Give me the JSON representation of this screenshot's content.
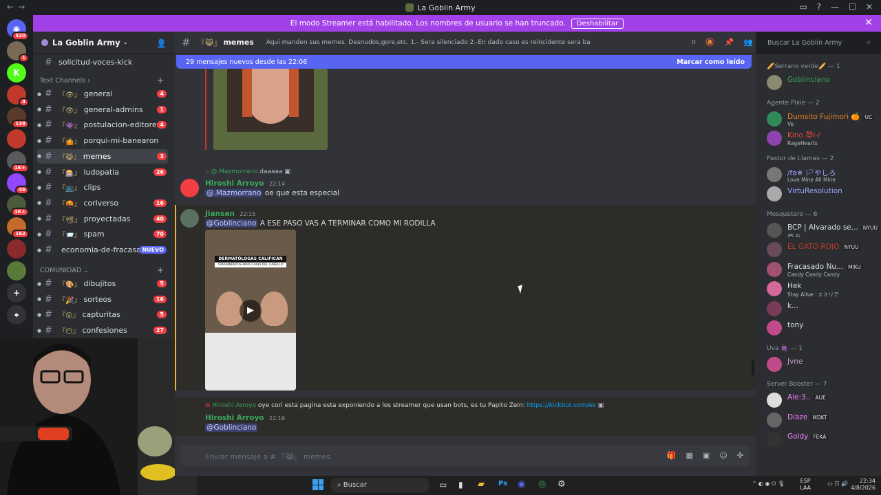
{
  "window": {
    "title": "La Goblin Army",
    "nav_back": "←",
    "nav_forward": "→"
  },
  "banner": {
    "text": "El modo Streamer está habilitado. Los nombres de usuario se han truncado.",
    "button": "Deshabilitar",
    "close": "✕"
  },
  "guilds": [
    {
      "label": "◉",
      "badge": "520",
      "color": "#5865f2"
    },
    {
      "label": "",
      "badge": "1",
      "color": "#7a6a55"
    },
    {
      "label": "K",
      "badge": "",
      "color": "#53fc18"
    },
    {
      "label": "",
      "badge": "4",
      "color": "#c0392b"
    },
    {
      "label": "",
      "badge": "138",
      "color": "#5a3a2a"
    },
    {
      "label": "",
      "badge": "",
      "color": "#c0392b"
    },
    {
      "label": "",
      "badge": "1K+",
      "color": "#5a5a5a"
    },
    {
      "label": "",
      "badge": "46",
      "color": "#9146ff"
    },
    {
      "label": "",
      "badge": "1K+",
      "color": "#4a5a3a"
    },
    {
      "label": "",
      "badge": "162",
      "color": "#c46a2a"
    },
    {
      "label": "",
      "badge": "",
      "color": "#8a2a2a"
    },
    {
      "label": "",
      "badge": "",
      "color": "#5a7a3a"
    },
    {
      "label": "+",
      "badge": "",
      "color": "#313338"
    },
    {
      "label": "⌖",
      "badge": "",
      "color": "#313338"
    }
  ],
  "sidebar": {
    "server_name": "La Goblin Army",
    "top_channel": "solicitud-voces-kick",
    "text_channels_label": "Text Channels",
    "channels": [
      {
        "emoji": "『👁』",
        "name": "general",
        "count": "4"
      },
      {
        "emoji": "『👁』",
        "name": "general-admins",
        "count": "1"
      },
      {
        "emoji": "『👾』",
        "name": "postulacion-editores",
        "count": "4"
      },
      {
        "emoji": "『🤷』",
        "name": "porqui-mi-banearon",
        "count": ""
      },
      {
        "emoji": "『😹』",
        "name": "memes",
        "count": "3",
        "active": true
      },
      {
        "emoji": "『🎰』",
        "name": "ludopatia",
        "count": "26"
      },
      {
        "emoji": "『📺』",
        "name": "clips",
        "count": ""
      },
      {
        "emoji": "『🤬』",
        "name": "coriverso",
        "count": "16"
      },
      {
        "emoji": "『📽』",
        "name": "proyectadas",
        "count": "40"
      },
      {
        "emoji": "『📨』",
        "name": "spam",
        "count": "70"
      },
      {
        "emoji": "",
        "name": "economia-de-fracasad...",
        "count": "NUEVO",
        "nuevo": true
      }
    ],
    "community_label": "COMUNIDAD",
    "community_channels": [
      {
        "emoji": "『🎨』",
        "name": "dibujitos",
        "count": "5"
      },
      {
        "emoji": "『🎉』",
        "name": "sorteos",
        "count": "16"
      },
      {
        "emoji": "『😮』",
        "name": "capturitas",
        "count": "5"
      },
      {
        "emoji": "『😶』",
        "name": "confesiones",
        "count": "27"
      }
    ]
  },
  "channel_header": {
    "emoji": "『😹』",
    "name": "memes",
    "topic": "Aqui manden sus memes. Desnudos,gore,etc. 1.- Sera silenciado 2.-En dado caso es reincidente sera baneado",
    "search_placeholder": "Buscar La Goblin Army"
  },
  "new_messages": {
    "text": "29 mensajes nuevos desde las 22:06",
    "mark_read": "Marcar como leído"
  },
  "messages": [
    {
      "reply_to": "@.Mazmorrano",
      "reply_text": "daaaaa",
      "author": "Hiroshi Arroyo",
      "time": "22:14",
      "mention": "@.Mazmorrano",
      "text": "oe que esta especial"
    },
    {
      "author": "Jiansan",
      "time": "22:15",
      "mention": "@Goblinciano",
      "text": "A ESE PASO VAS A TERMINAR COMO MI RODILLA",
      "video_caption_1": "DERMATÓLOGAS CALIFICAN",
      "video_caption_2": "TRATAMIENTOS PARA CAIDA DEL CABELLO"
    },
    {
      "reply_to": "Hiroshi Arroyo",
      "reply_text": "oye cori esta pagina esta exponiendo a los streamer que usan bots, es tu Papito Zein:",
      "reply_link": "https://kickbot.com/es",
      "author": "Hiroshi Arroyo",
      "time": "22:16",
      "mention": "@Goblinciano"
    }
  ],
  "composer": {
    "placeholder": "Enviar mensaje a # 『😹』 memes"
  },
  "members": {
    "sections": [
      {
        "title": "🥖Serrano verde🥖 — 1",
        "items": [
          {
            "name": "Goblinciano",
            "status": "",
            "color": "#3ba55d",
            "av": "#8a8a70"
          }
        ]
      },
      {
        "title": "Agente Pixie — 2",
        "items": [
          {
            "name": "Dumsito Fujimori 🍊",
            "tag": "UC",
            "status": "Ve",
            "color": "#e67e22",
            "av": "#2e8b57"
          },
          {
            "name": "Kino 😈I-/",
            "status": "RageHearts",
            "color": "#e74c3c",
            "av": "#8e44ad"
          }
        ]
      },
      {
        "title": "Pastor de Llamas — 2",
        "items": [
          {
            "name": "/fa❄ 🏳やしろ",
            "status": "Love Mine All Mine",
            "color": "#9aa7ff",
            "av": "#777"
          },
          {
            "name": "VirtuResolution",
            "status": "",
            "color": "#9aa7ff",
            "av": "#aaa"
          }
        ]
      },
      {
        "title": "Mosquetero — 6",
        "items": [
          {
            "name": "BCP | Alvarado se...",
            "tag": "NYUU",
            "status": "🎮 z₁",
            "color": "#dbdee1",
            "av": "#555"
          },
          {
            "name": "EL GATO ROJO",
            "tag": "NYUU",
            "status": "",
            "color": "#c0392b",
            "av": "#6a4a5a"
          },
          {
            "name": "Fracasado Nu...",
            "tag": "MIKU",
            "status": "Candy Candy Candy",
            "color": "#dbdee1",
            "av": "#a05070"
          },
          {
            "name": "Hek",
            "status": "Stay Alive · エミリア",
            "color": "#dbdee1",
            "av": "#d4689a"
          },
          {
            "name": "k...",
            "status": "",
            "color": "#dbdee1",
            "av": "#7a3a5a"
          },
          {
            "name": "tony",
            "status": "",
            "color": "#dbdee1",
            "av": "#c04a8a"
          }
        ]
      },
      {
        "title": "Uva 🍇 — 1",
        "items": [
          {
            "name": "Jvne",
            "status": "",
            "color": "#c39bd3",
            "av": "#c04a8a"
          }
        ]
      },
      {
        "title": "Server Booster — 7",
        "items": [
          {
            "name": "Ale:3..",
            "tag": "AUE",
            "status": "",
            "color": "#f47fff",
            "av": "#ddd"
          },
          {
            "name": "Diaze",
            "tag": "MDKT",
            "status": "",
            "color": "#f47fff",
            "av": "#666"
          },
          {
            "name": "Goldy",
            "tag": "FEKA",
            "status": "",
            "color": "#f47fff",
            "av": "#333"
          }
        ]
      }
    ]
  },
  "taskbar": {
    "search": "Buscar",
    "lang_1": "ESP",
    "lang_2": "LAA",
    "time": "22:34",
    "date": "4/8/2026"
  }
}
